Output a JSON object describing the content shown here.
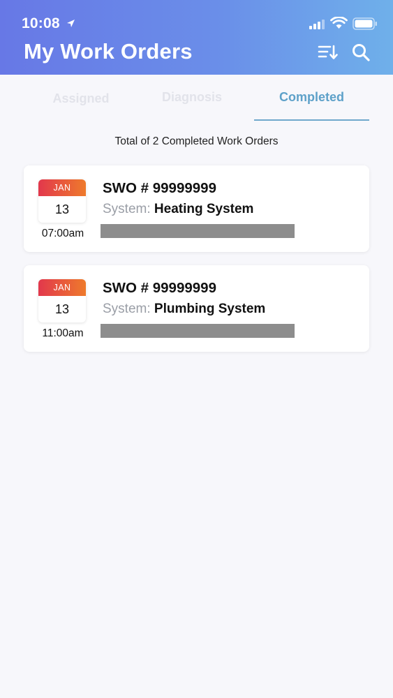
{
  "status_bar": {
    "time": "10:08",
    "icons": [
      "location-arrow-icon",
      "signal-icon",
      "wifi-icon",
      "battery-icon"
    ]
  },
  "header": {
    "title": "My Work Orders",
    "actions": [
      "sort-icon",
      "search-icon"
    ],
    "gradient": [
      "#6778e6",
      "#6fb0ea"
    ]
  },
  "tabs": [
    {
      "label": "Assigned",
      "active": false
    },
    {
      "label": "Diagnosis",
      "active": false
    },
    {
      "label": "Completed",
      "active": true
    }
  ],
  "summary": "Total of 2 Completed Work Orders",
  "work_orders": [
    {
      "month": "JAN",
      "day": "13",
      "time": "07:00am",
      "swo": "SWO # 99999999",
      "system_label": "System:",
      "system_value": "Heating System"
    },
    {
      "month": "JAN",
      "day": "13",
      "time": "11:00am",
      "swo": "SWO # 99999999",
      "system_label": "System:",
      "system_value": "Plumbing System"
    }
  ],
  "colors": {
    "accent": "#5ea1c9",
    "calendar_gradient": [
      "#e2384c",
      "#ee7a2c"
    ],
    "redacted": "#8d8d8d"
  }
}
